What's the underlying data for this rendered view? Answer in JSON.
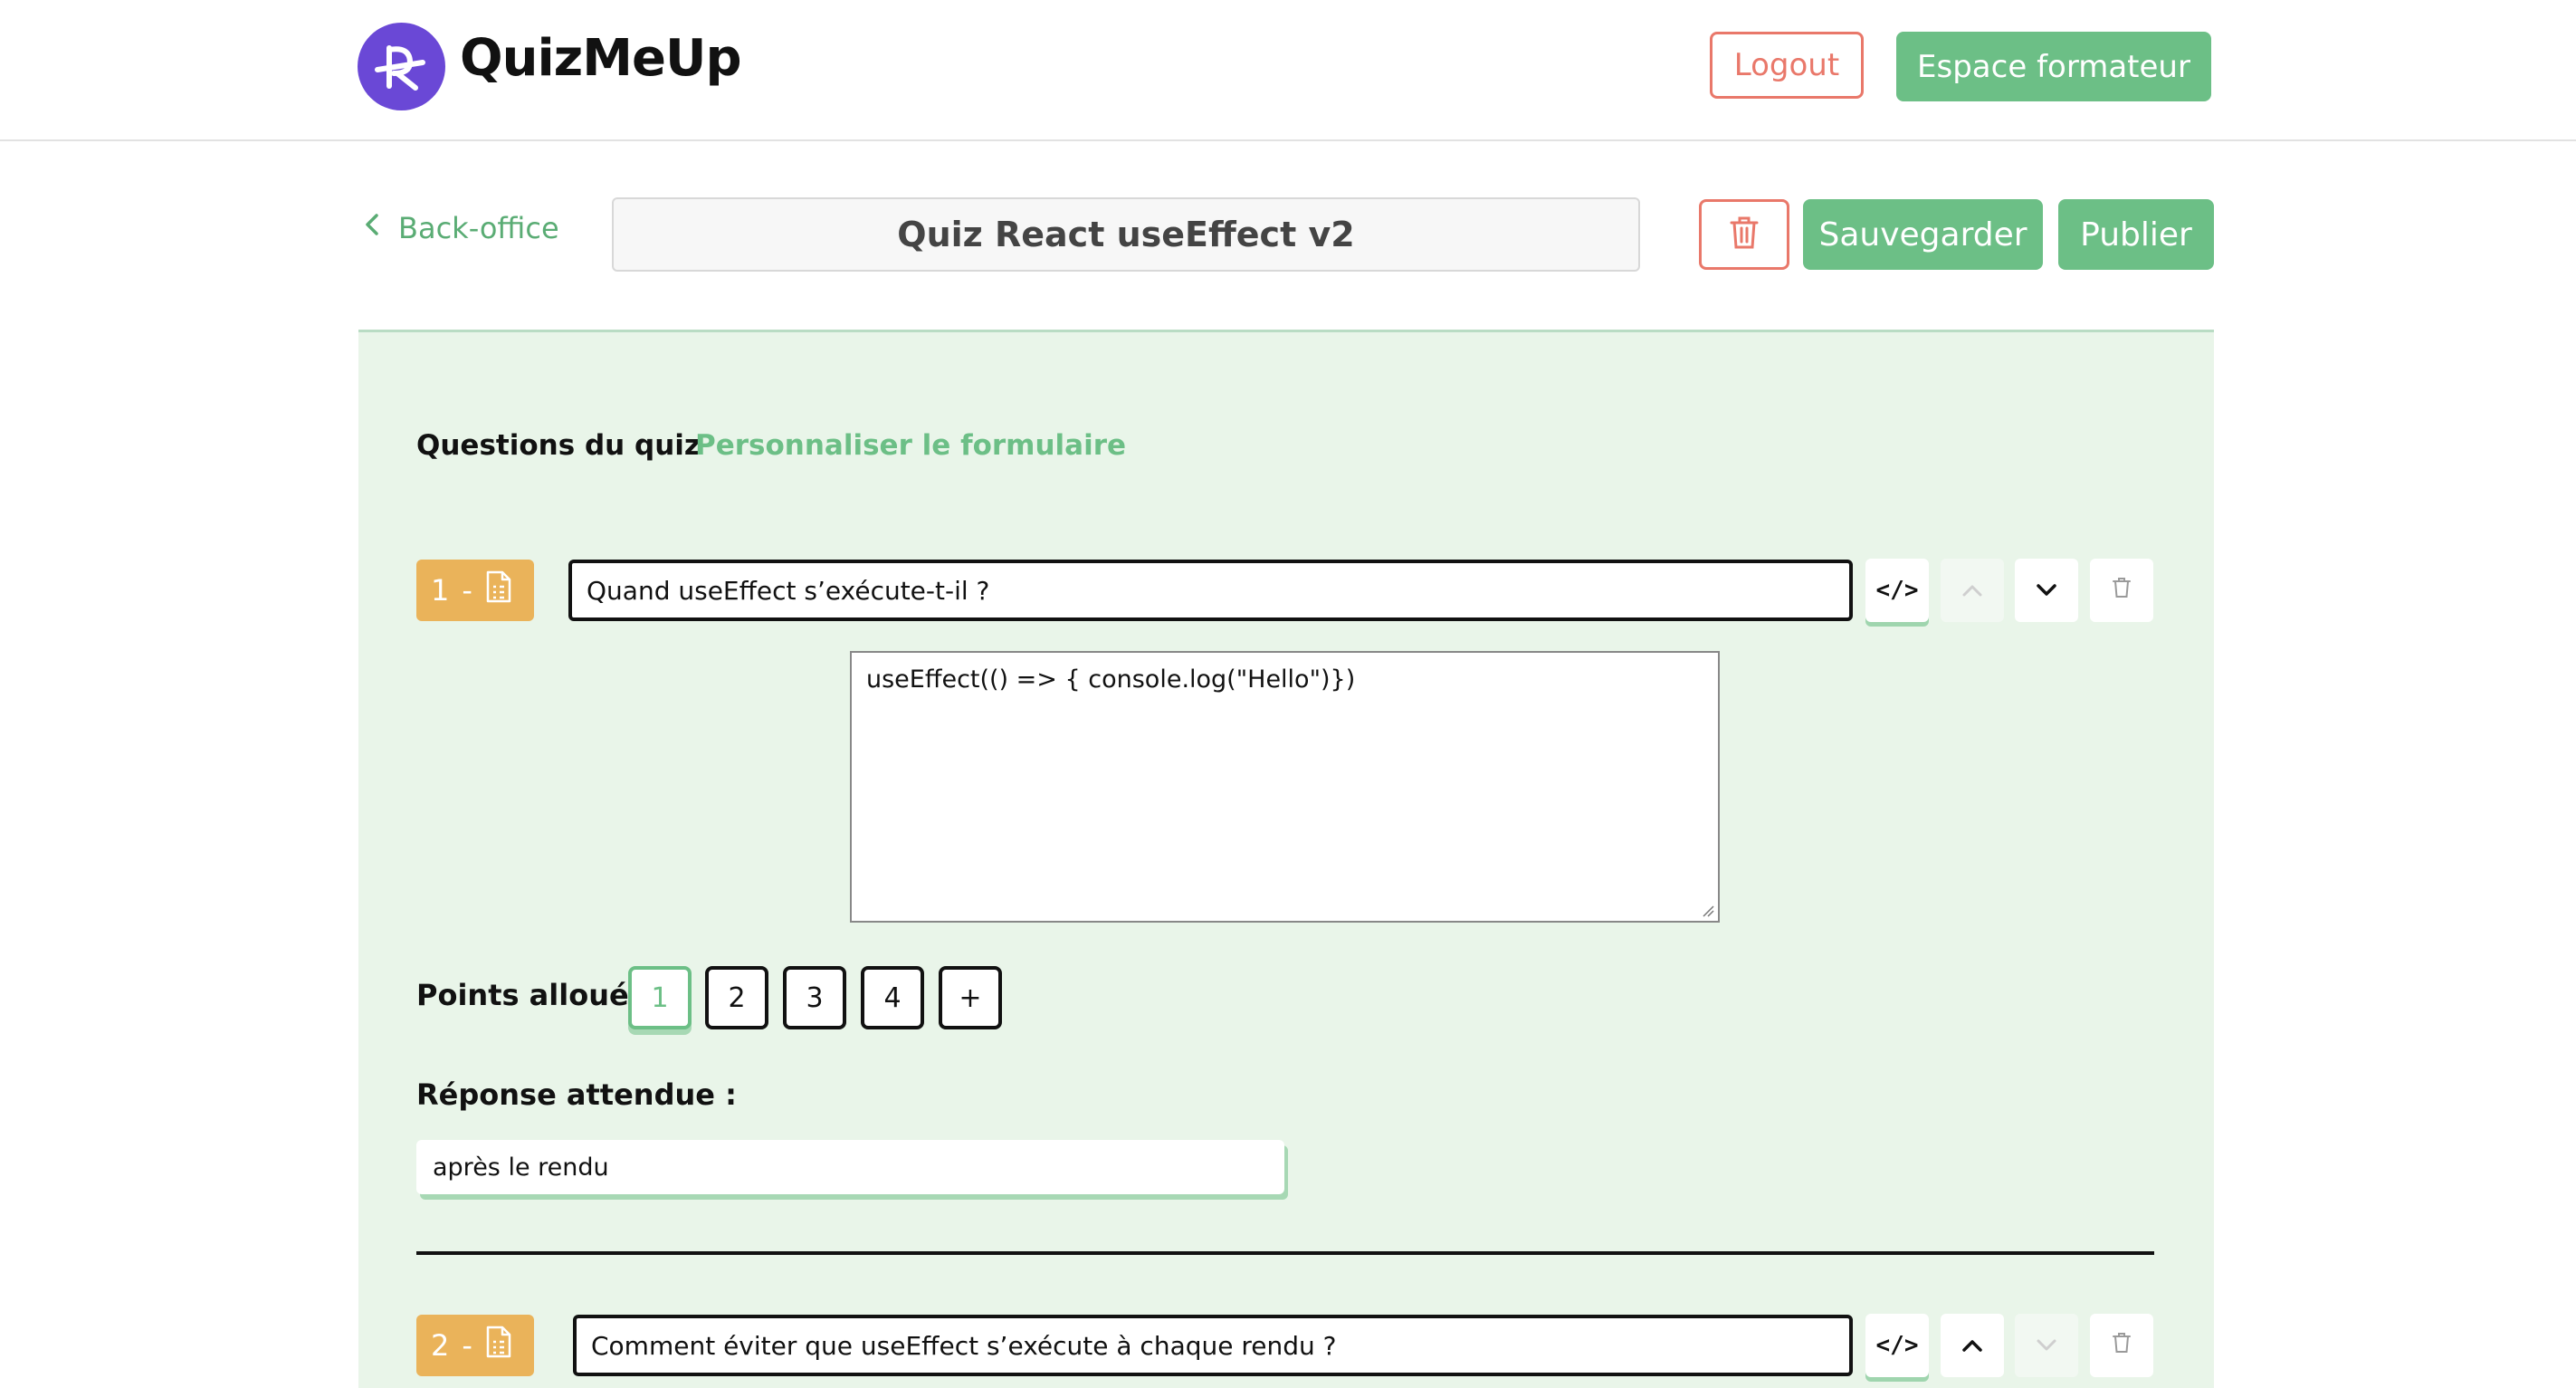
{
  "header": {
    "brand": "QuizMeUp",
    "logout_label": "Logout",
    "trainer_space_label": "Espace formateur"
  },
  "toolbar": {
    "back_label": "Back-office",
    "quiz_title": "Quiz React useEffect v2",
    "save_label": "Sauvegarder",
    "publish_label": "Publier"
  },
  "tabs": {
    "questions": "Questions du quiz",
    "customize": "Personnaliser le formulaire"
  },
  "questions": [
    {
      "number": "1",
      "separator": "-",
      "text": "Quand useEffect s’exécute-t-il ?",
      "code": "useEffect(() => { console.log(\"Hello\")})",
      "points_label": "Points alloués:",
      "points_options": [
        "1",
        "2",
        "3",
        "4",
        "+"
      ],
      "points_selected": "1",
      "answer_label": "Réponse attendue :",
      "answer": "après le rendu"
    },
    {
      "number": "2",
      "separator": "-",
      "text": "Comment éviter que useEffect s’exécute à chaque rendu ?"
    }
  ],
  "icons": {
    "code": "</>",
    "up": "chevron-up-icon",
    "down": "chevron-down-icon",
    "delete": "trash-icon",
    "doc": "document-icon"
  },
  "colors": {
    "accent_green": "#6cbf86",
    "danger": "#e9786a",
    "question_badge": "#eab35a",
    "brand_purple": "#6a48d6",
    "panel_bg": "#e9f5e9"
  }
}
